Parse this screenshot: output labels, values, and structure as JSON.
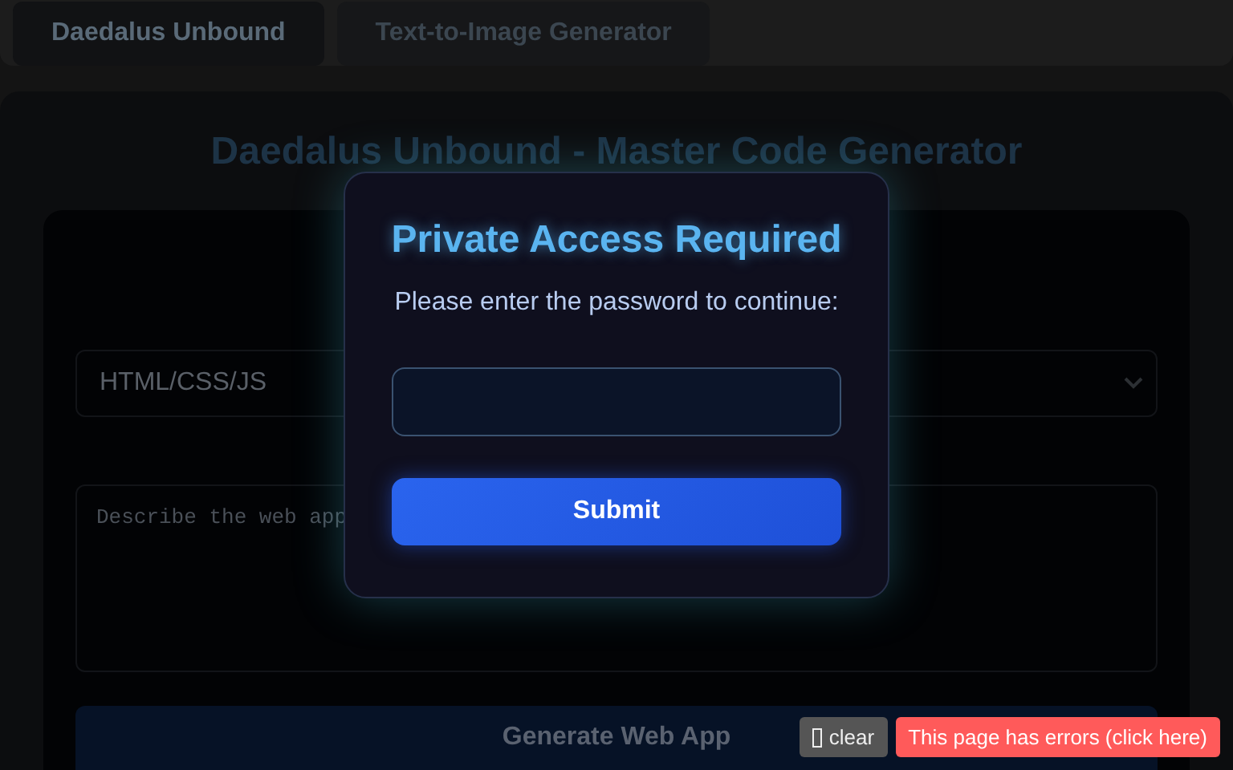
{
  "tabs": [
    {
      "label": "Daedalus Unbound",
      "selected": true
    },
    {
      "label": "Text-to-Image Generator",
      "selected": false
    }
  ],
  "page": {
    "title": "Daedalus Unbound - Master Code Generator",
    "language_select": {
      "value": "HTML/CSS/JS"
    },
    "description": {
      "placeholder": "Describe the web app"
    },
    "generate_button": "Generate Web App"
  },
  "modal": {
    "title": "Private Access Required",
    "message": "Please enter the password to continue:",
    "submit": "Submit"
  },
  "error_bar": {
    "clear": "clear",
    "errors": "This page has errors (click here)"
  }
}
